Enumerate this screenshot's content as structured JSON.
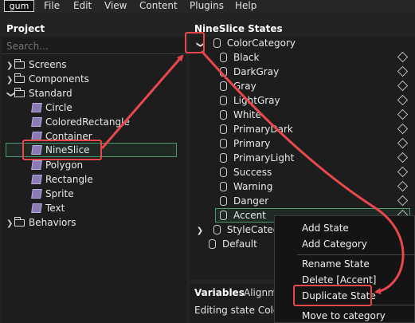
{
  "menubar": {
    "logo": "gum",
    "items": [
      "File",
      "Edit",
      "View",
      "Content",
      "Plugins",
      "Help"
    ]
  },
  "project": {
    "title": "Project",
    "search_placeholder": "Search...",
    "folders": [
      "Screens",
      "Components",
      "Standard",
      "Behaviors"
    ],
    "standard_items": [
      "Circle",
      "ColoredRectangle",
      "Container",
      "NineSlice",
      "Polygon",
      "Rectangle",
      "Sprite",
      "Text"
    ],
    "selected": "NineSlice"
  },
  "states": {
    "title": "NineSlice States",
    "category": "ColorCategory",
    "items": [
      "Black",
      "DarkGray",
      "Gray",
      "LightGray",
      "White",
      "PrimaryDark",
      "Primary",
      "PrimaryLight",
      "Success",
      "Warning",
      "Danger",
      "Accent"
    ],
    "style_category": "StyleCategory",
    "default": "Default"
  },
  "bottom": {
    "tabs": [
      "Variables",
      "Alignme"
    ],
    "editing": "Editing state ColorC"
  },
  "context_menu": {
    "items": [
      "Add State",
      "Add Category",
      "Rename State",
      "Delete [Accent]",
      "Duplicate State",
      "Move to category"
    ]
  },
  "colors": {
    "annotation": "#e8474c",
    "selection_border": "#4c9a6e",
    "background": "#232323"
  }
}
